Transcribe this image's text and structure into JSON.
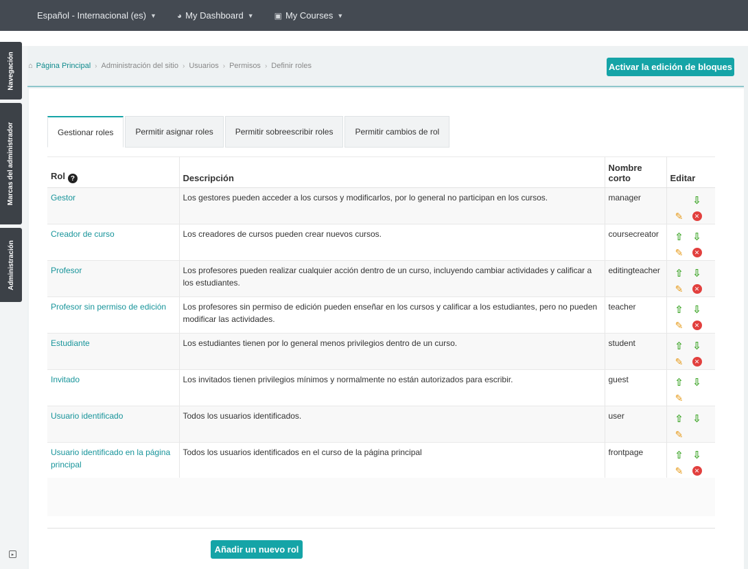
{
  "navbar": {
    "language": "Español - Internacional (es)",
    "dashboard": "My Dashboard",
    "courses": "My Courses"
  },
  "side_blocks": [
    "Navegación",
    "Marcas del administrador",
    "Administración"
  ],
  "breadcrumb": {
    "home": "Página Principal",
    "items": [
      "Administración del sitio",
      "Usuarios",
      "Permisos",
      "Definir roles"
    ]
  },
  "edit_blocks_button": "Activar la edición de bloques",
  "tabs": [
    "Gestionar roles",
    "Permitir asignar roles",
    "Permitir sobreescribir roles",
    "Permitir cambios de rol"
  ],
  "table": {
    "headers": {
      "role": "Rol",
      "description": "Descripción",
      "shortname_line1": "Nombre",
      "shortname_line2": "corto",
      "edit": "Editar"
    },
    "rows": [
      {
        "name": "Gestor",
        "description": "Los gestores pueden acceder a los cursos y modificarlos, por lo general no participan en los cursos.",
        "shortname": "manager"
      },
      {
        "name": "Creador de curso",
        "description": "Los creadores de cursos pueden crear nuevos cursos.",
        "shortname": "coursecreator"
      },
      {
        "name": "Profesor",
        "description": "Los profesores pueden realizar cualquier acción dentro de un curso, incluyendo cambiar actividades y calificar a los estudiantes.",
        "shortname": "editingteacher"
      },
      {
        "name": "Profesor sin permiso de edición",
        "description": "Los profesores sin permiso de edición pueden enseñar en los cursos y calificar a los estudiantes, pero no pueden modificar las actividades.",
        "shortname": "teacher"
      },
      {
        "name": "Estudiante",
        "description": "Los estudiantes tienen por lo general menos privilegios dentro de un curso.",
        "shortname": "student"
      },
      {
        "name": "Invitado",
        "description": "Los invitados tienen privilegios mínimos y normalmente no están autorizados para escribir.",
        "shortname": "guest"
      },
      {
        "name": "Usuario identificado",
        "description": "Todos los usuarios identificados.",
        "shortname": "user"
      },
      {
        "name": "Usuario identificado en la página principal",
        "description": "Todos los usuarios identificados en el curso de la página principal",
        "shortname": "frontpage"
      }
    ]
  },
  "add_role_button": "Añadir un nuevo rol",
  "colors": {
    "accent": "#15a4a7",
    "navbar": "#444a52",
    "link": "#17949a"
  }
}
